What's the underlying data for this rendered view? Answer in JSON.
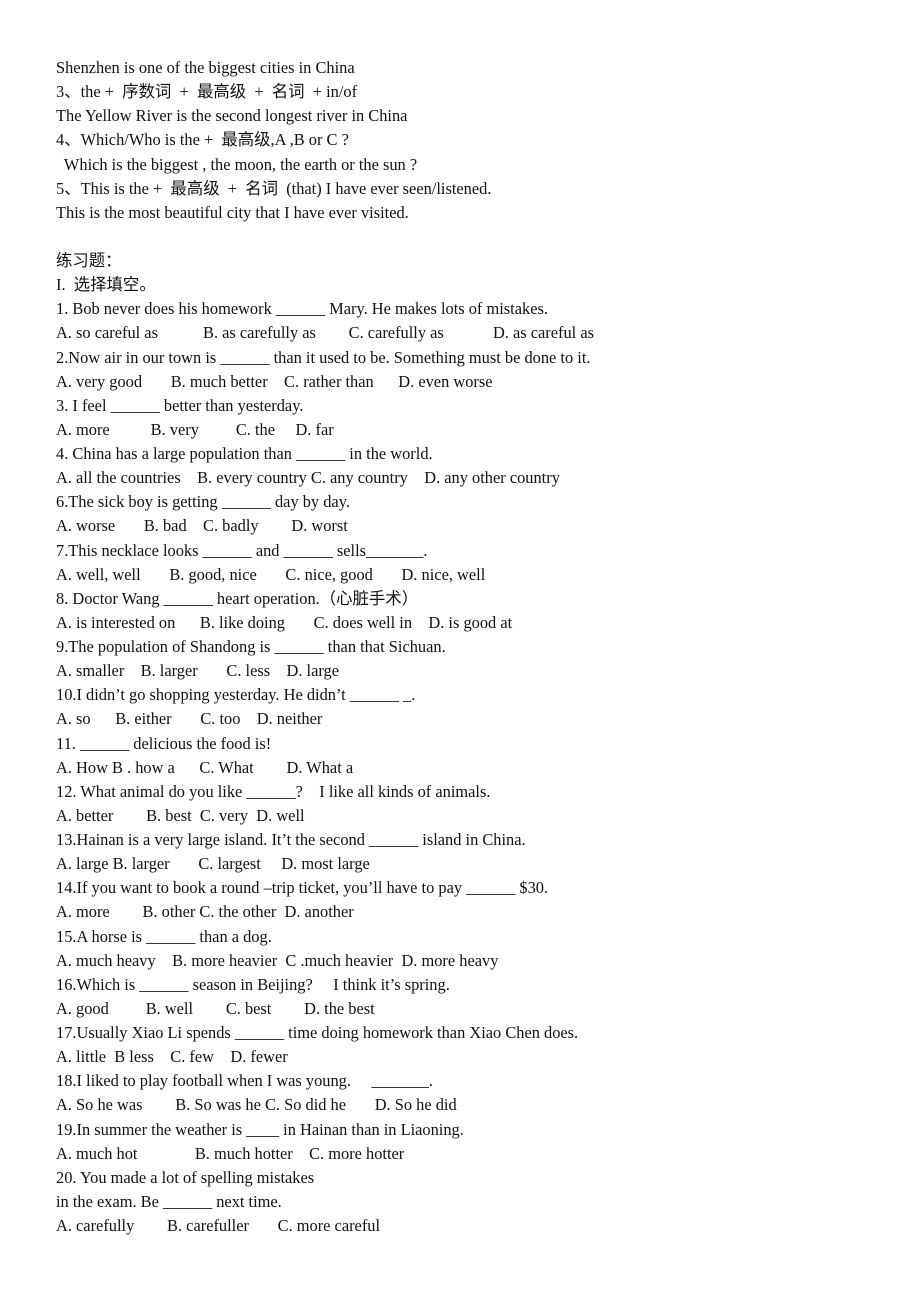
{
  "document": {
    "lines": [
      "Shenzhen is one of the biggest cities in China",
      "3、the +  序数词  +  最高级  +  名词  + in/of",
      "The Yellow River is the second longest river in China",
      "4、Which/Who is the +  最高级,A ,B or C ?",
      "  Which is the biggest , the moon, the earth or the sun ?",
      "5、This is the +  最高级  +  名词  (that) I have ever seen/listened.",
      "This is the most beautiful city that I have ever visited.",
      "",
      "练习题：",
      "I.  选择填空。",
      "1. Bob never does his homework ______ Mary. He makes lots of mistakes.",
      "A. so careful as           B. as carefully as        C. carefully as            D. as careful as",
      "2.Now air in our town is ______ than it used to be. Something must be done to it.",
      "A. very good       B. much better    C. rather than      D. even worse",
      "3. I feel ______ better than yesterday.",
      "A. more          B. very         C. the     D. far",
      "4. China has a large population than ______ in the world.",
      "A. all the countries    B. every country C. any country    D. any other country",
      "6.The sick boy is getting ______ day by day.",
      "A. worse       B. bad    C. badly        D. worst",
      "7.This necklace looks ______ and ______ sells_______.",
      "A. well, well       B. good, nice       C. nice, good       D. nice, well",
      "8. Doctor Wang ______ heart operation.（心脏手术）",
      "A. is interested on      B. like doing       C. does well in    D. is good at",
      "9.The population of Shandong is ______ than that Sichuan.",
      "A. smaller    B. larger       C. less    D. large",
      "10.I didn’t go shopping yesterday. He didn’t ______ _.",
      "A. so      B. either       C. too    D. neither",
      "11. ______ delicious the food is!",
      "A. How B . how a      C. What        D. What a",
      "12. What animal do you like ______?    I like all kinds of animals.",
      "A. better        B. best  C. very  D. well",
      "13.Hainan is a very large island. It’t the second ______ island in China.",
      "A. large B. larger       C. largest     D. most large",
      "14.If you want to book a round –trip ticket, you’ll have to pay ______ $30.",
      "A. more        B. other C. the other  D. another",
      "15.A horse is ______ than a dog.",
      "A. much heavy    B. more heavier  C .much heavier  D. more heavy",
      "16.Which is ______ season in Beijing?     I think it’s spring.",
      "A. good         B. well        C. best        D. the best",
      "17.Usually Xiao Li spends ______ time doing homework than Xiao Chen does.",
      "A. little  B less    C. few    D. fewer",
      "18.I liked to play football when I was young.     _______.",
      "A. So he was        B. So was he C. So did he       D. So he did",
      "19.In summer the weather is ____ in Hainan than in Liaoning.",
      "A. much hot              B. much hotter    C. more hotter",
      "20. You made a lot of spelling mistakes",
      "in the exam. Be ______ next time.",
      "A. carefully        B. carefuller       C. more careful"
    ]
  }
}
